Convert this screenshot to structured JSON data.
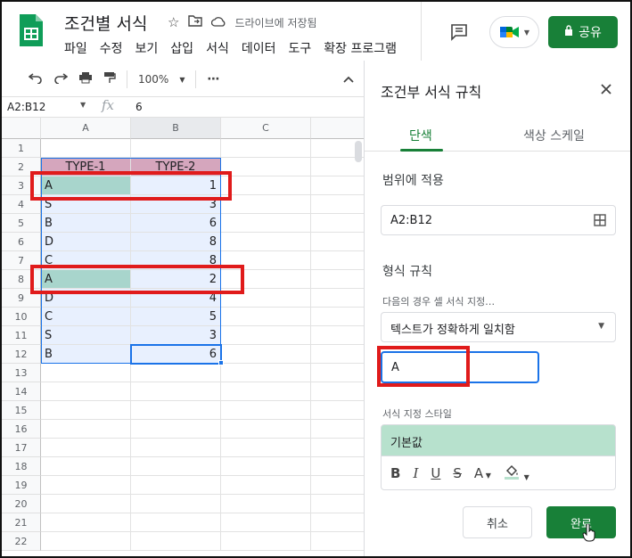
{
  "app": {
    "title": "조건별 서식",
    "saved_status": "드라이브에 저장됨",
    "menu": [
      "파일",
      "수정",
      "보기",
      "삽입",
      "서식",
      "데이터",
      "도구",
      "확장 프로그램"
    ],
    "share_label": "공유"
  },
  "toolbar": {
    "zoom": "100%"
  },
  "formula_bar": {
    "name_box": "A2:B12",
    "fx": "fx",
    "value": "6"
  },
  "sheet": {
    "columns": [
      "A",
      "B",
      "C"
    ],
    "rows": [
      "1",
      "2",
      "3",
      "4",
      "5",
      "6",
      "7",
      "8",
      "9",
      "10",
      "11",
      "12",
      "13",
      "14",
      "15",
      "16",
      "17",
      "18",
      "19",
      "20",
      "21",
      "22"
    ],
    "header": [
      "TYPE-1",
      "TYPE-2"
    ],
    "data": [
      {
        "a": "A",
        "b": "1"
      },
      {
        "a": "S",
        "b": "3"
      },
      {
        "a": "B",
        "b": "6"
      },
      {
        "a": "D",
        "b": "8"
      },
      {
        "a": "C",
        "b": "8"
      },
      {
        "a": "A",
        "b": "2"
      },
      {
        "a": "D",
        "b": "4"
      },
      {
        "a": "C",
        "b": "5"
      },
      {
        "a": "S",
        "b": "3"
      },
      {
        "a": "B",
        "b": "6"
      }
    ]
  },
  "panel": {
    "title": "조건부 서식 규칙",
    "tabs": [
      "단색",
      "색상 스케일"
    ],
    "range_label": "범위에 적용",
    "range_value": "A2:B12",
    "rules_label": "형식 규칙",
    "condition_label": "다음의 경우 셀 서식 지정…",
    "condition_value": "텍스트가 정확하게 일치함",
    "value_input": "A",
    "style_label": "서식 지정 스타일",
    "style_preview": "기본값",
    "style_tools": [
      "B",
      "I",
      "U",
      "S",
      "A"
    ],
    "cancel_label": "취소",
    "done_label": "완료"
  },
  "colors": {
    "brand_green": "#188038",
    "header_fill": "#d5a6bd",
    "highlight_fill": "#a8d5cc",
    "selection_blue": "#1a73e8",
    "annotation_red": "#e01b1b"
  }
}
